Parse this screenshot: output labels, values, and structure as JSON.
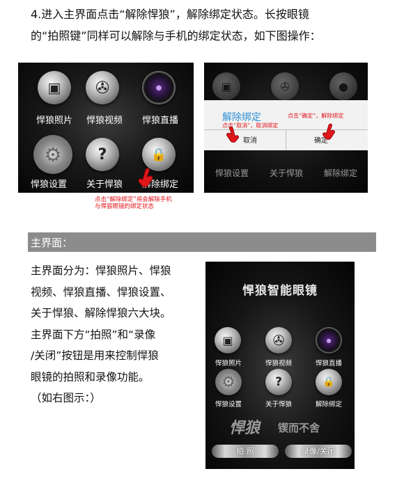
{
  "paragraph": {
    "line1": "4.进入主界面点击“解除悍狼”，解除绑定状态。长按眼镜",
    "line2": "的“拍照键”同样可以解除与手机的绑定状态，如下图操作："
  },
  "screen1": {
    "buttons": [
      "悍狼照片",
      "悍狼视频",
      "悍狼直播",
      "悍狼设置",
      "关于悍狼",
      "解除绑定"
    ]
  },
  "screen1_caption": {
    "line1": "点击“解除绑定”将会解除手机",
    "line2": "与悍狼眼镜的绑定状态"
  },
  "screen2": {
    "labels": [
      "悍狼设置",
      "关于悍狼",
      "解除绑定"
    ],
    "dialog_title": "解除绑定",
    "cancel": "取消",
    "confirm": "确定",
    "note_confirm": "点击“确定”，解除绑定",
    "note_cancel": "点击“取消”，取消绑定"
  },
  "section": {
    "title": "主界面："
  },
  "body": {
    "lines": [
      "主界面分为：悍狼照片、悍狼",
      "视频、悍狼直播、悍狼设置、",
      "关于悍狼、解除悍狼六大块。",
      "主界面下方“拍照”和“录像",
      "/关闭”按钮是用来控制悍狼",
      "眼镜的拍照和录像功能。",
      "（如右图示：）"
    ]
  },
  "screen3": {
    "title": "悍狼智能眼镜",
    "buttons": [
      "悍狼照片",
      "悍狼视频",
      "悍狼直播",
      "悍狼设置",
      "关于悍狼",
      "解除绑定"
    ],
    "brand_left": "悍狼",
    "brand_right": "锲而不舍",
    "photo_button": "拍  照",
    "record_button": "录像/关闭"
  },
  "colors": {
    "annotation_red": "#e0161b",
    "dialog_title_blue": "#2d8fd5",
    "section_bar": "#8c8c8c"
  },
  "icons": [
    "photo-icon",
    "film-reel-icon",
    "camera-lens-icon",
    "gear-icon",
    "question-icon",
    "lock-icon",
    "pointing-hand-icon"
  ]
}
